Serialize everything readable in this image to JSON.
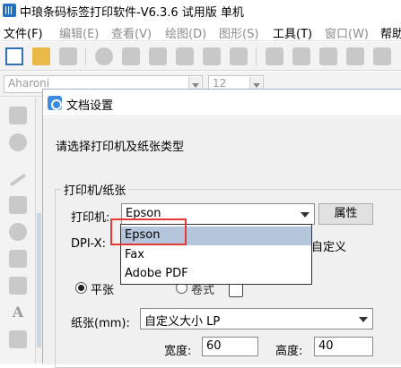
{
  "app": {
    "title": "中琅条码标签打印软件-V6.3.6 试用版 单机"
  },
  "menubar": {
    "items": [
      {
        "label": "文件(F)",
        "enabled": true
      },
      {
        "label": "编辑(E)",
        "enabled": false
      },
      {
        "label": "查看(V)",
        "enabled": false
      },
      {
        "label": "绘图(D)",
        "enabled": false
      },
      {
        "label": "图形(S)",
        "enabled": false
      },
      {
        "label": "工具(T)",
        "enabled": true
      },
      {
        "label": "窗口(W)",
        "enabled": false
      },
      {
        "label": "帮助",
        "enabled": true
      }
    ]
  },
  "fontbar": {
    "font_name": "Aharoni",
    "font_size": "12"
  },
  "dialog": {
    "title": "文档设置",
    "instruction": "请选择打印机及纸张类型",
    "group_label": "打印机/纸张",
    "printer": {
      "label": "打印机:",
      "selected": "Epson",
      "properties_button": "属性"
    },
    "dpi": {
      "label": "DPI-X:",
      "custom_label": "自定义"
    },
    "orientation": {
      "portrait_label": "平张",
      "landscape_label": "卷式",
      "selected": "portrait"
    },
    "paper": {
      "label": "纸张(mm):",
      "selected": "自定义大小 LP"
    },
    "size": {
      "width_label": "宽度:",
      "width_value": "60",
      "height_label": "高度:",
      "height_value": "40"
    },
    "printer_dropdown": {
      "options": [
        "Epson",
        "Fax",
        "Adobe PDF"
      ],
      "highlighted_index": 0
    }
  },
  "colors": {
    "highlight_box": "#e53935",
    "dropdown_selection": "#b5c6dc",
    "dialog_background": "#f0f0f0"
  }
}
